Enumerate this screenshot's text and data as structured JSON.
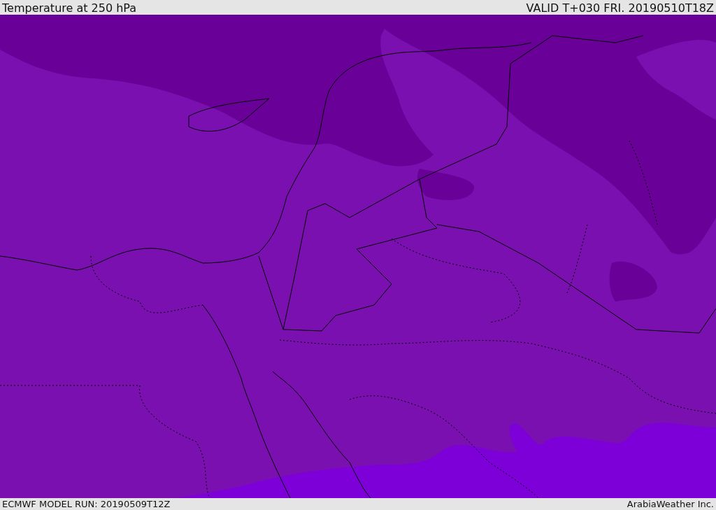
{
  "header": {
    "title": "Temperature at 250 hPa",
    "valid_time": "VALID T+030 FRI. 20190510T18Z"
  },
  "footer": {
    "model_run": "ECMWF MODEL RUN: 20190509T12Z",
    "credit": "ArabiaWeather Inc."
  }
}
